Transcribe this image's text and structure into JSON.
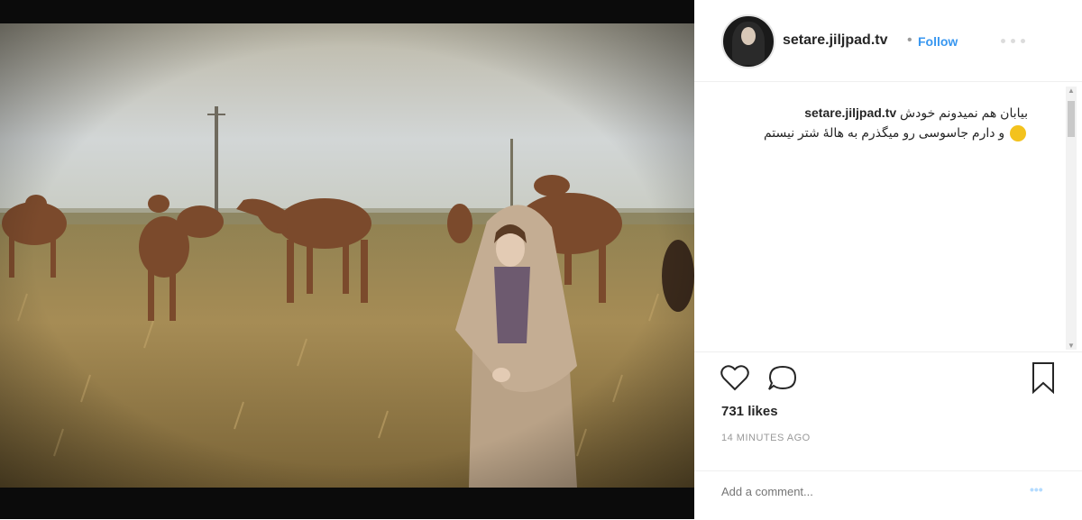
{
  "post": {
    "username": "setare.jiljpad.tv",
    "separator": "•",
    "follow_label": "Follow",
    "caption_user": "setare.jiljpad.tv",
    "caption_text_1": "بیابان هم نمیدونم خودش",
    "caption_text_2": "و دارم جاسوسی رو میگذرم به هالۀ شتر نیستم",
    "likes": "731 likes",
    "time_ago": "14 MINUTES AGO",
    "comment_placeholder": "Add a comment...",
    "post_label": "•••"
  },
  "icons": {
    "like": "heart-icon",
    "comment": "comment-bubble-icon",
    "save": "bookmark-icon",
    "more": "more-options-icon"
  },
  "colors": {
    "accent": "#3897f0",
    "text": "#262626",
    "muted": "#999999",
    "photo_frame": "#0b0b0b"
  }
}
